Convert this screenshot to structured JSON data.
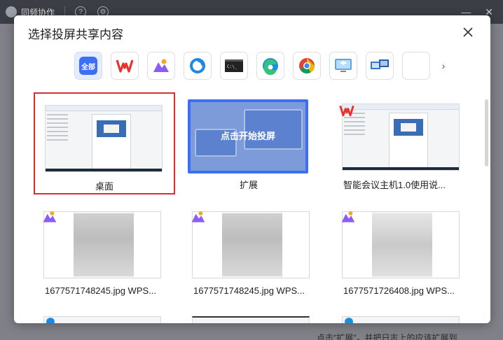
{
  "background": {
    "app_title": "同频协作",
    "bottom_text": "点击\"扩展\"，并把日志上的应该扩展到"
  },
  "dialog": {
    "title": "选择投屏共享内容",
    "apps": [
      {
        "name": "all",
        "label": "全部",
        "active": true
      },
      {
        "name": "wps"
      },
      {
        "name": "photos"
      },
      {
        "name": "blue-clock"
      },
      {
        "name": "terminal"
      },
      {
        "name": "edge"
      },
      {
        "name": "chrome"
      },
      {
        "name": "monitor"
      },
      {
        "name": "remote-desktop"
      },
      {
        "name": "blank"
      }
    ],
    "extend_overlay": "点击开始投屏",
    "cards": [
      {
        "label": "桌面",
        "selected": true
      },
      {
        "label": "扩展"
      },
      {
        "label": "智能会议主机1.0使用说..."
      },
      {
        "label": "1677571748245.jpg WPS..."
      },
      {
        "label": "1677571748245.jpg WPS..."
      },
      {
        "label": "1677571726408.jpg WPS..."
      }
    ]
  },
  "colors": {
    "accent": "#3f6ef6",
    "selected_border": "#d6302b",
    "wps_red": "#e8322e"
  }
}
